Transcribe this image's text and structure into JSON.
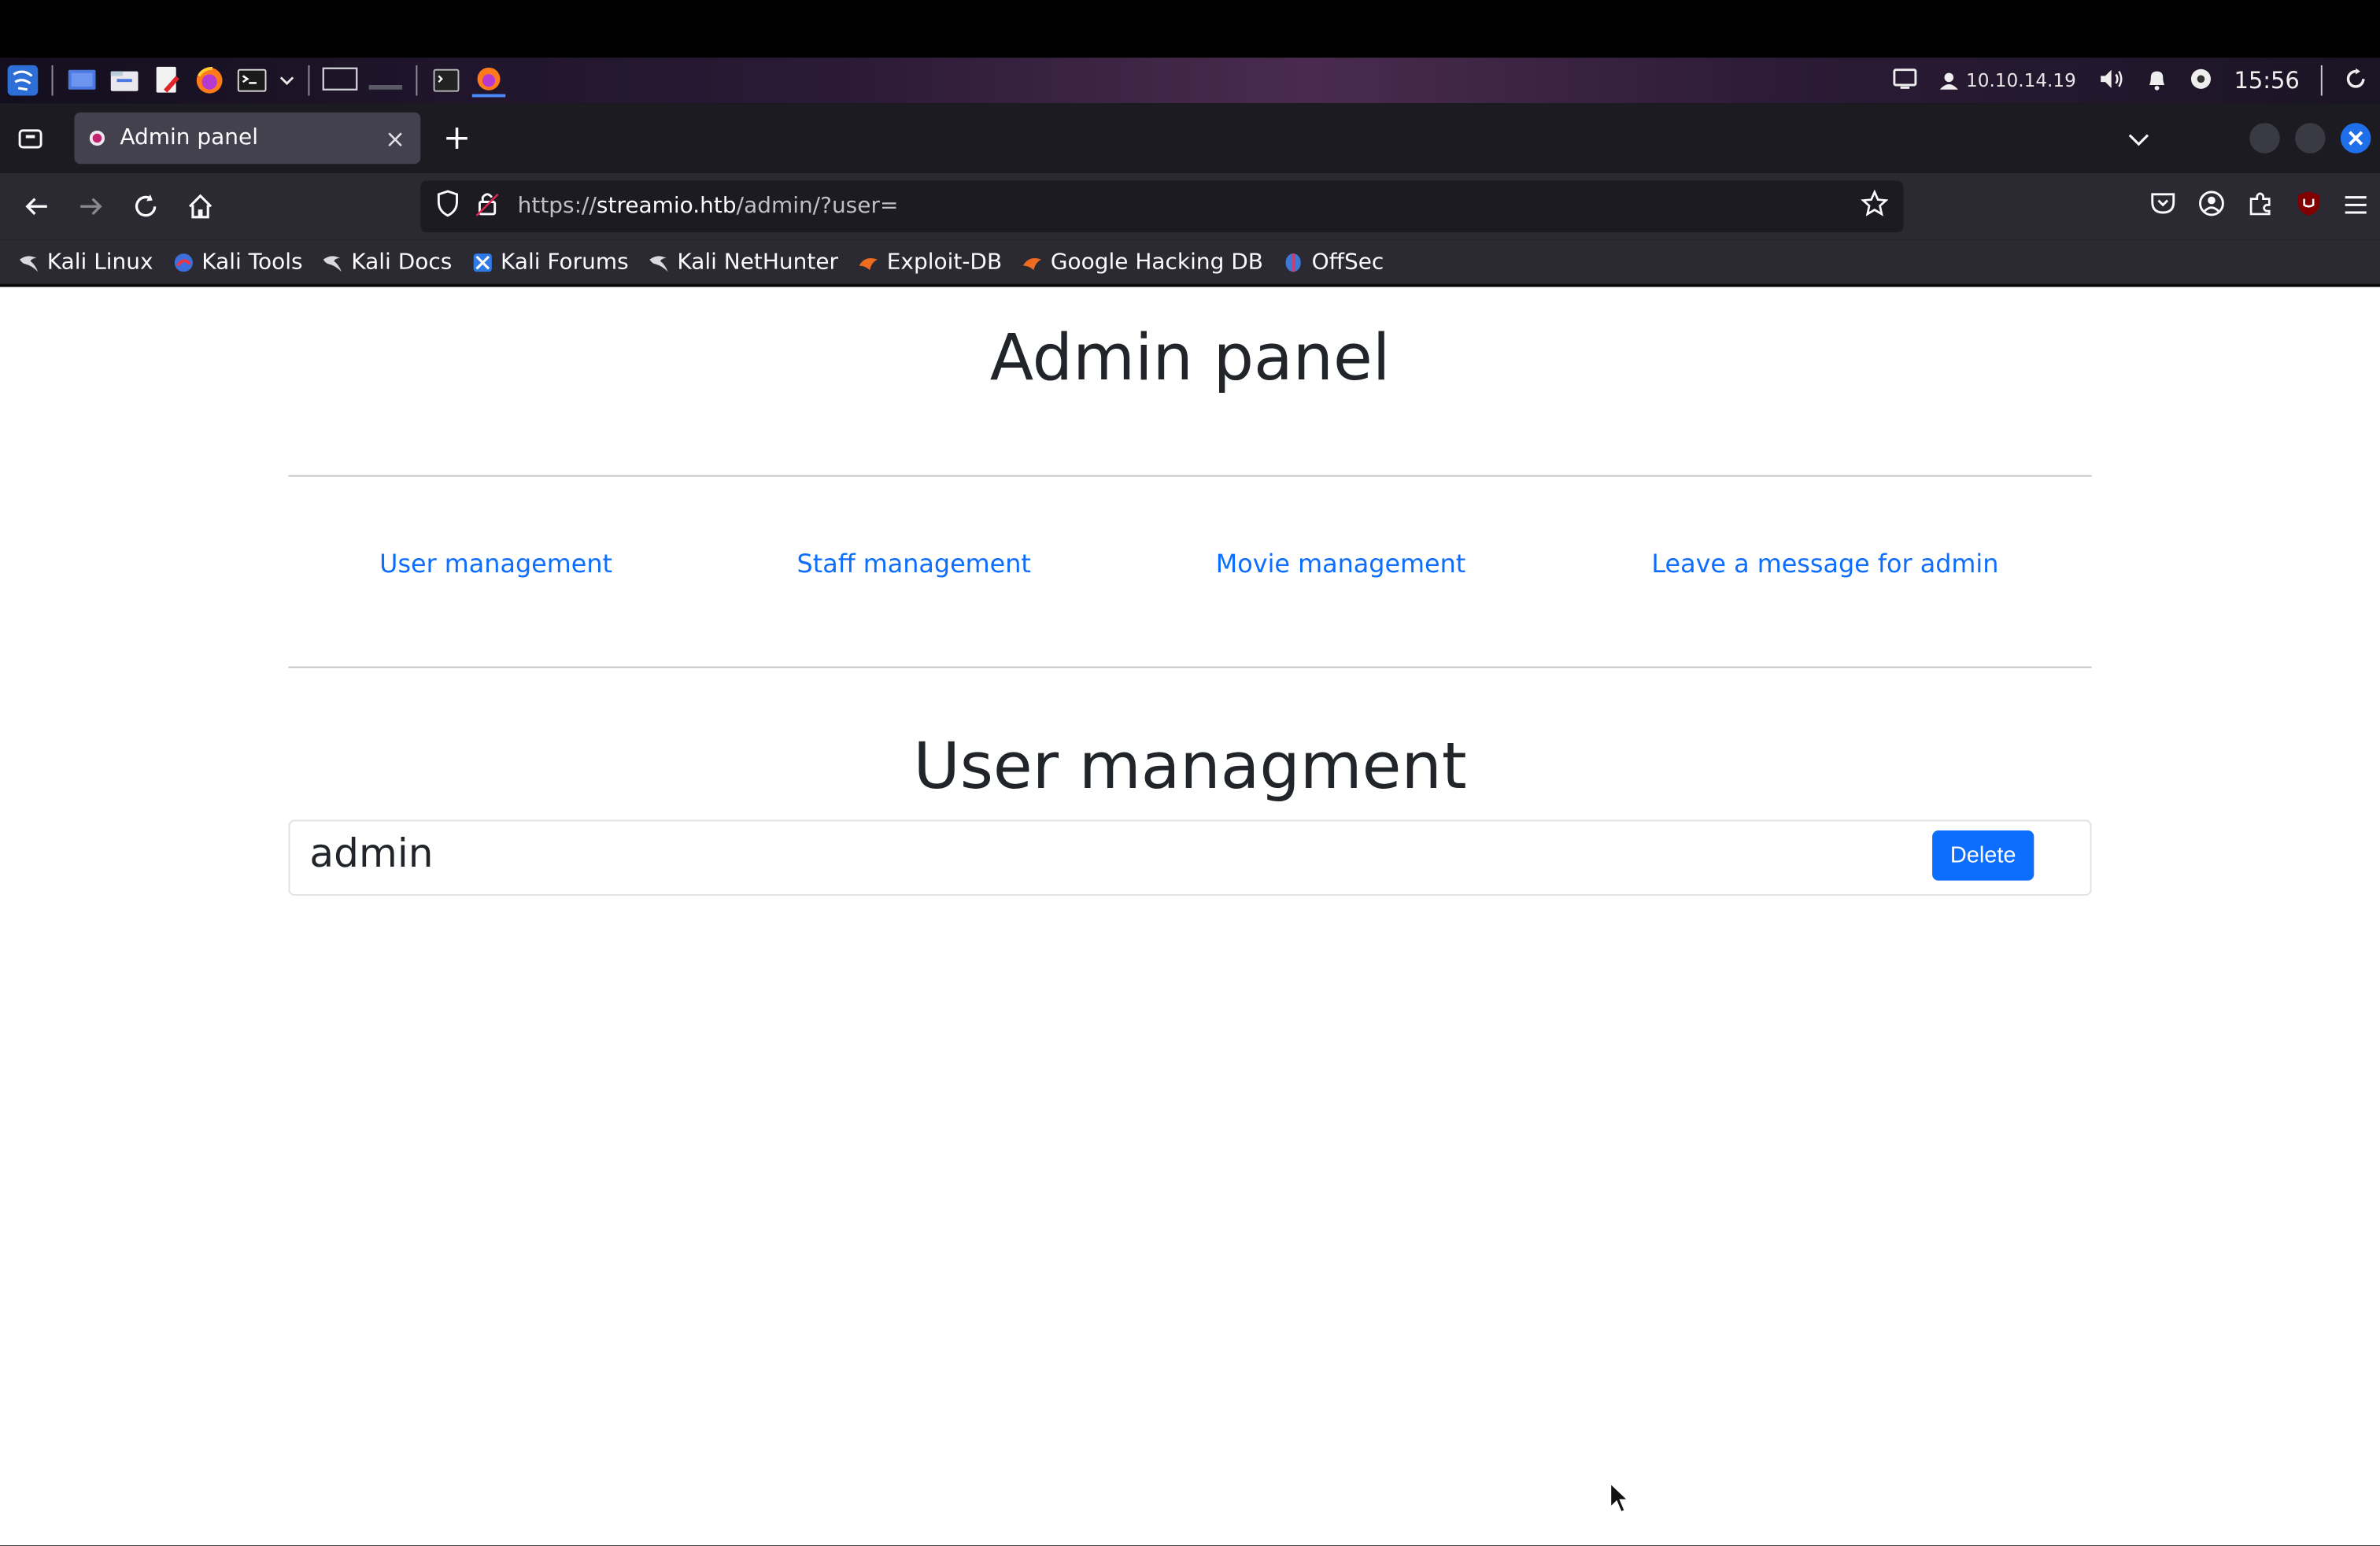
{
  "taskbar": {
    "network_ip": "10.10.14.19",
    "clock": "15:56"
  },
  "browser": {
    "tab_title": "Admin panel",
    "tab_close": "×",
    "new_tab": "+",
    "url_scheme": "https://",
    "url_host": "streamio.htb",
    "url_path": "/admin/?user=",
    "bookmarks": [
      {
        "label": "Kali Linux",
        "icon": "kali-dragon-icon"
      },
      {
        "label": "Kali Tools",
        "icon": "kali-tools-icon"
      },
      {
        "label": "Kali Docs",
        "icon": "kali-dragon-icon"
      },
      {
        "label": "Kali Forums",
        "icon": "kali-forums-icon"
      },
      {
        "label": "Kali NetHunter",
        "icon": "kali-dragon-icon"
      },
      {
        "label": "Exploit-DB",
        "icon": "exploit-db-icon"
      },
      {
        "label": "Google Hacking DB",
        "icon": "exploit-db-icon"
      },
      {
        "label": "OffSec",
        "icon": "offsec-icon"
      }
    ]
  },
  "page": {
    "title": "Admin panel",
    "menu": [
      "User management",
      "Staff management",
      "Movie management",
      "Leave a message for admin"
    ],
    "section_title": "User managment",
    "users": [
      {
        "name": "admin",
        "action": "Delete"
      }
    ]
  },
  "colors": {
    "link": "#0d6efd",
    "button": "#0d6efd",
    "browser_chrome": "#2b2a33",
    "tab_strip": "#1c1b22"
  }
}
